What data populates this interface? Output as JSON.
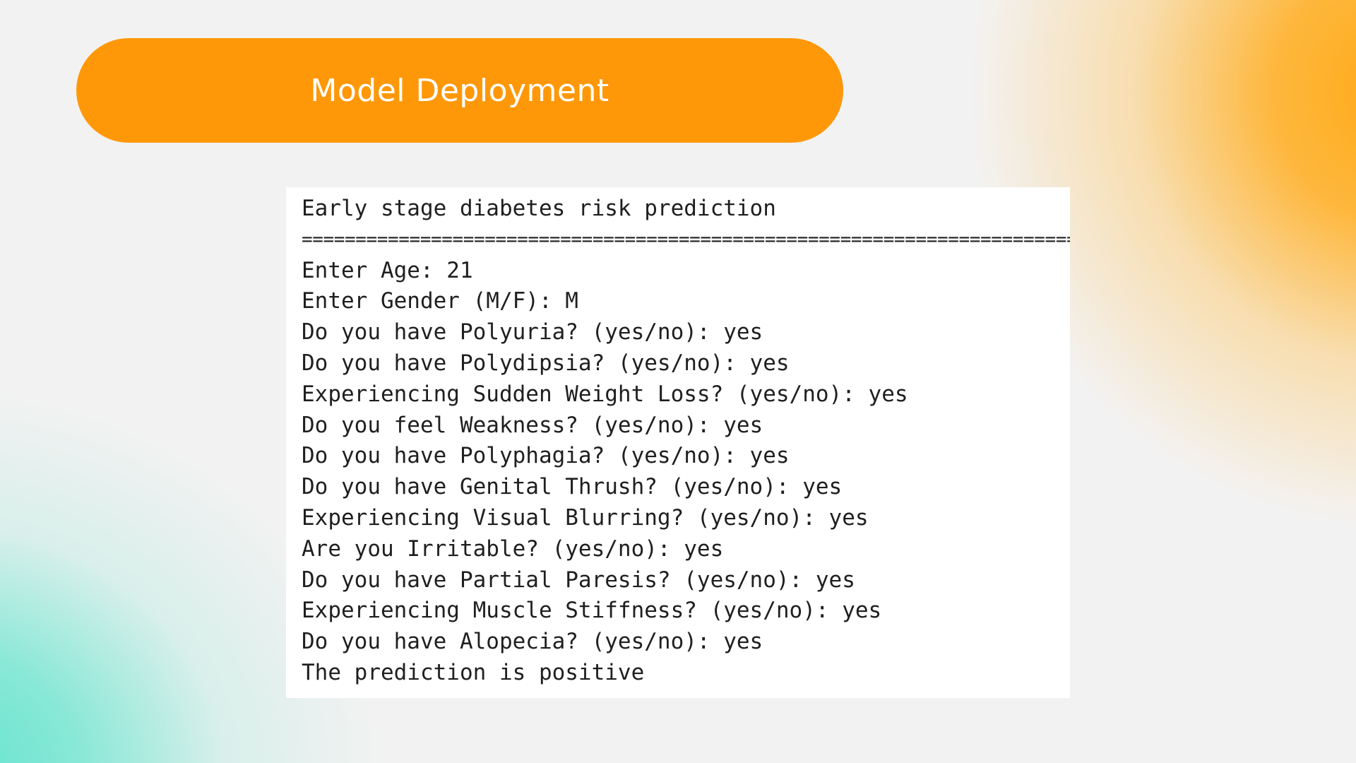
{
  "slide": {
    "title": "Model Deployment"
  },
  "console": {
    "heading": "Early stage diabetes risk prediction",
    "divider": "==========================================================================",
    "lines": [
      "Enter Age: 21",
      "Enter Gender (M/F): M",
      "Do you have Polyuria? (yes/no): yes",
      "Do you have Polydipsia? (yes/no): yes",
      "Experiencing Sudden Weight Loss? (yes/no): yes",
      "Do you feel Weakness? (yes/no): yes",
      "Do you have Polyphagia? (yes/no): yes",
      "Do you have Genital Thrush? (yes/no): yes",
      "Experiencing Visual Blurring? (yes/no): yes",
      "Are you Irritable? (yes/no): yes",
      "Do you have Partial Paresis? (yes/no): yes",
      "Experiencing Muscle Stiffness? (yes/no): yes",
      "Do you have Alopecia? (yes/no): yes",
      "The prediction is positive"
    ]
  },
  "colors": {
    "accent": "#ff9809",
    "background": "#f3f2f2",
    "console_background": "#ffffff",
    "console_text": "#1f1f1f"
  }
}
